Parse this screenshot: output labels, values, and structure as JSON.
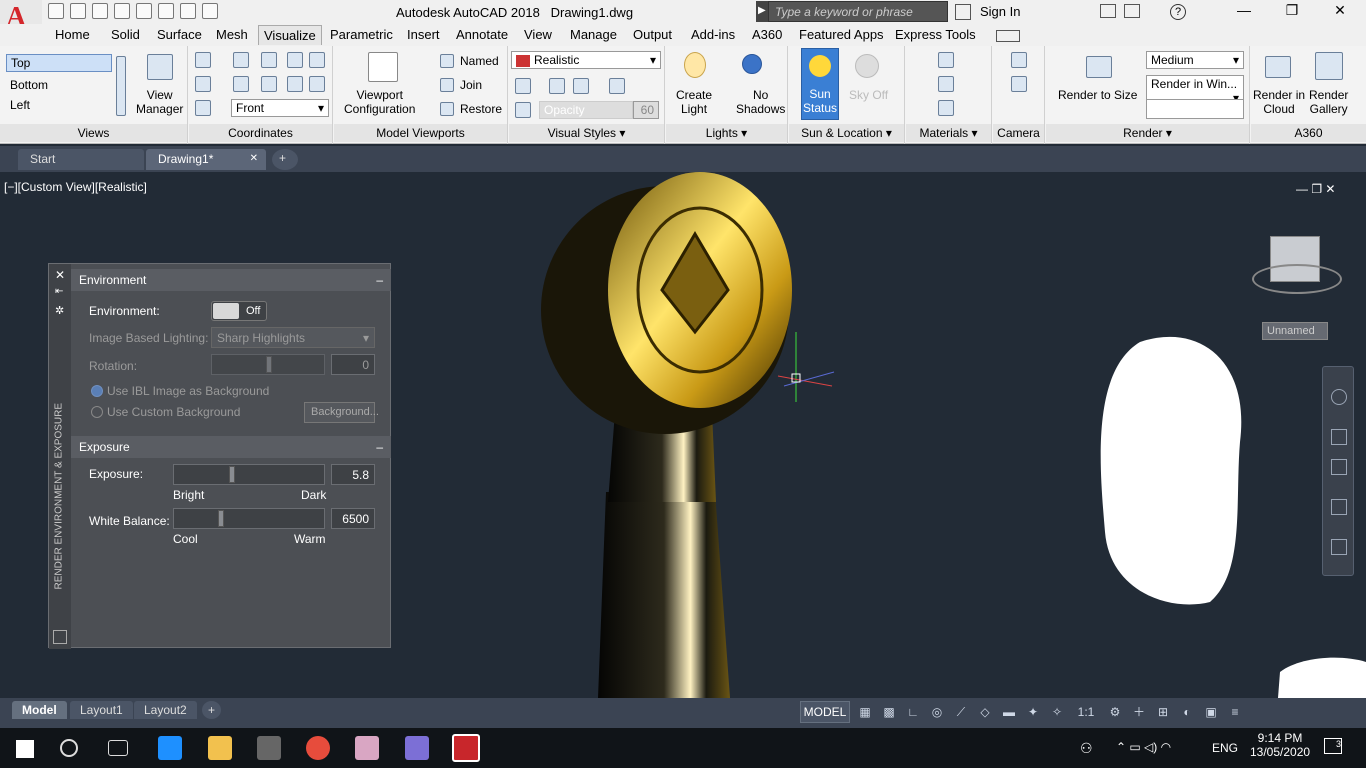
{
  "app": {
    "title": "Autodesk AutoCAD 2018",
    "filename": "Drawing1.dwg",
    "logo_letter": "A"
  },
  "search": {
    "placeholder": "Type a keyword or phrase"
  },
  "user": {
    "signin": "Sign In"
  },
  "window": {
    "min": "—",
    "max": "❐",
    "close": "✕"
  },
  "menu_tabs": [
    "Home",
    "Solid",
    "Surface",
    "Mesh",
    "Visualize",
    "Parametric",
    "Insert",
    "Annotate",
    "View",
    "Manage",
    "Output",
    "Add-ins",
    "A360",
    "Featured Apps",
    "Express Tools"
  ],
  "ribbon": {
    "views": {
      "label": "Views",
      "items": [
        "Top",
        "Bottom",
        "Left"
      ],
      "manager": "View\nManager"
    },
    "coordinates": {
      "label": "Coordinates",
      "front": "Front"
    },
    "model_viewports": {
      "label": "Model Viewports",
      "config": "Viewport\nConfiguration",
      "named": "Named",
      "join": "Join",
      "restore": "Restore"
    },
    "visual_styles": {
      "label": "Visual Styles",
      "style": "Realistic",
      "opacity": "Opacity",
      "opacity_value": "60"
    },
    "lights": {
      "label": "Lights",
      "create": "Create\nLight",
      "no_shadows": "No\nShadows"
    },
    "sun_location": {
      "label": "Sun & Location",
      "sun_status": "Sun\nStatus",
      "sky_off": "Sky Off"
    },
    "materials": {
      "label": "Materials"
    },
    "camera": {
      "label": "Camera"
    },
    "render": {
      "label": "Render",
      "render_to_size": "Render to Size",
      "quality": "Medium",
      "render_in": "Render in Win..."
    },
    "a360": {
      "label": "A360",
      "cloud": "Render in\nCloud",
      "gallery": "Render\nGallery"
    }
  },
  "doc_tabs": {
    "start": "Start",
    "drawing": "Drawing1*",
    "close": "✕",
    "add": "+"
  },
  "viewport": {
    "label": "[−][Custom View][Realistic]",
    "named_view": "Unnamed"
  },
  "render_panel": {
    "title": "RENDER ENVIRONMENT & EXPOSURE",
    "environment": {
      "header": "Environment",
      "collapse": "–",
      "environment_label": "Environment:",
      "toggle": "Off",
      "ibl_label": "Image Based Lighting:",
      "ibl_value": "Sharp Highlights",
      "rotation_label": "Rotation:",
      "rotation_value": "0",
      "opt1": "Use IBL Image as Background",
      "opt2": "Use Custom Background",
      "bg_button": "Background..."
    },
    "exposure": {
      "header": "Exposure",
      "collapse": "–",
      "exposure_label": "Exposure:",
      "exposure_value": "5.8",
      "exposure_fraction": 0.38,
      "bright": "Bright",
      "dark": "Dark",
      "wb_label": "White Balance:",
      "wb_value": "6500",
      "wb_fraction": 0.3,
      "cool": "Cool",
      "warm": "Warm"
    }
  },
  "layouts": {
    "model": "Model",
    "layout1": "Layout1",
    "layout2": "Layout2",
    "add": "+"
  },
  "status": {
    "model": "MODEL",
    "scale": "1:1"
  },
  "clock": {
    "time": "9:14 PM",
    "date": "13/05/2020",
    "lang": "ENG",
    "notifications": "3"
  }
}
